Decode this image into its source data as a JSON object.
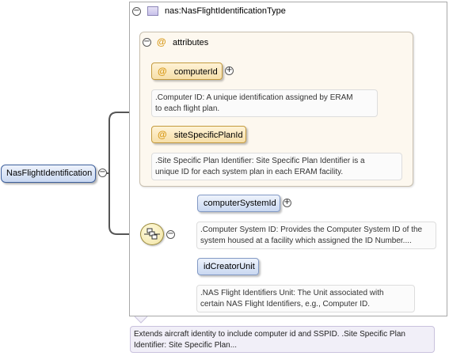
{
  "type": {
    "name": "nas:NasFlightIdentificationType"
  },
  "attributes": {
    "label": "attributes",
    "symbol": "@",
    "items": [
      {
        "name": "computerId",
        "doc": [
          ".Computer ID: A unique identification assigned by ERAM",
          "to each flight plan."
        ]
      },
      {
        "name": "siteSpecificPlanId",
        "doc": [
          ".Site Specific Plan Identifier: Site Specific Plan Identifier is a",
          "unique ID for each system plan in each ERAM facility."
        ]
      }
    ]
  },
  "root": {
    "name": "NasFlightIdentification"
  },
  "sequence": {
    "children": [
      {
        "name": "computerSystemId",
        "doc": [
          ".Computer System ID: Provides the Computer System ID of the",
          "system housed at a facility which assigned the ID Number...."
        ]
      },
      {
        "name": "idCreatorUnit",
        "doc": [
          ".NAS Flight Identifiers Unit: The Unit associated with",
          "certain NAS Flight Identifiers, e.g., Computer ID."
        ]
      }
    ]
  },
  "root_doc": [
    "Extends aircraft identity to include computer id and SSPID. .Site Specific Plan",
    "Identifier: Site Specific Plan..."
  ],
  "symbols": {
    "minus": "−",
    "plus": "+"
  },
  "colors": {
    "element_fill": "#c9d8f1",
    "attribute_fill": "#f6dfa9",
    "attribute_symbol": "#d89a1a",
    "connector": "#555555"
  }
}
